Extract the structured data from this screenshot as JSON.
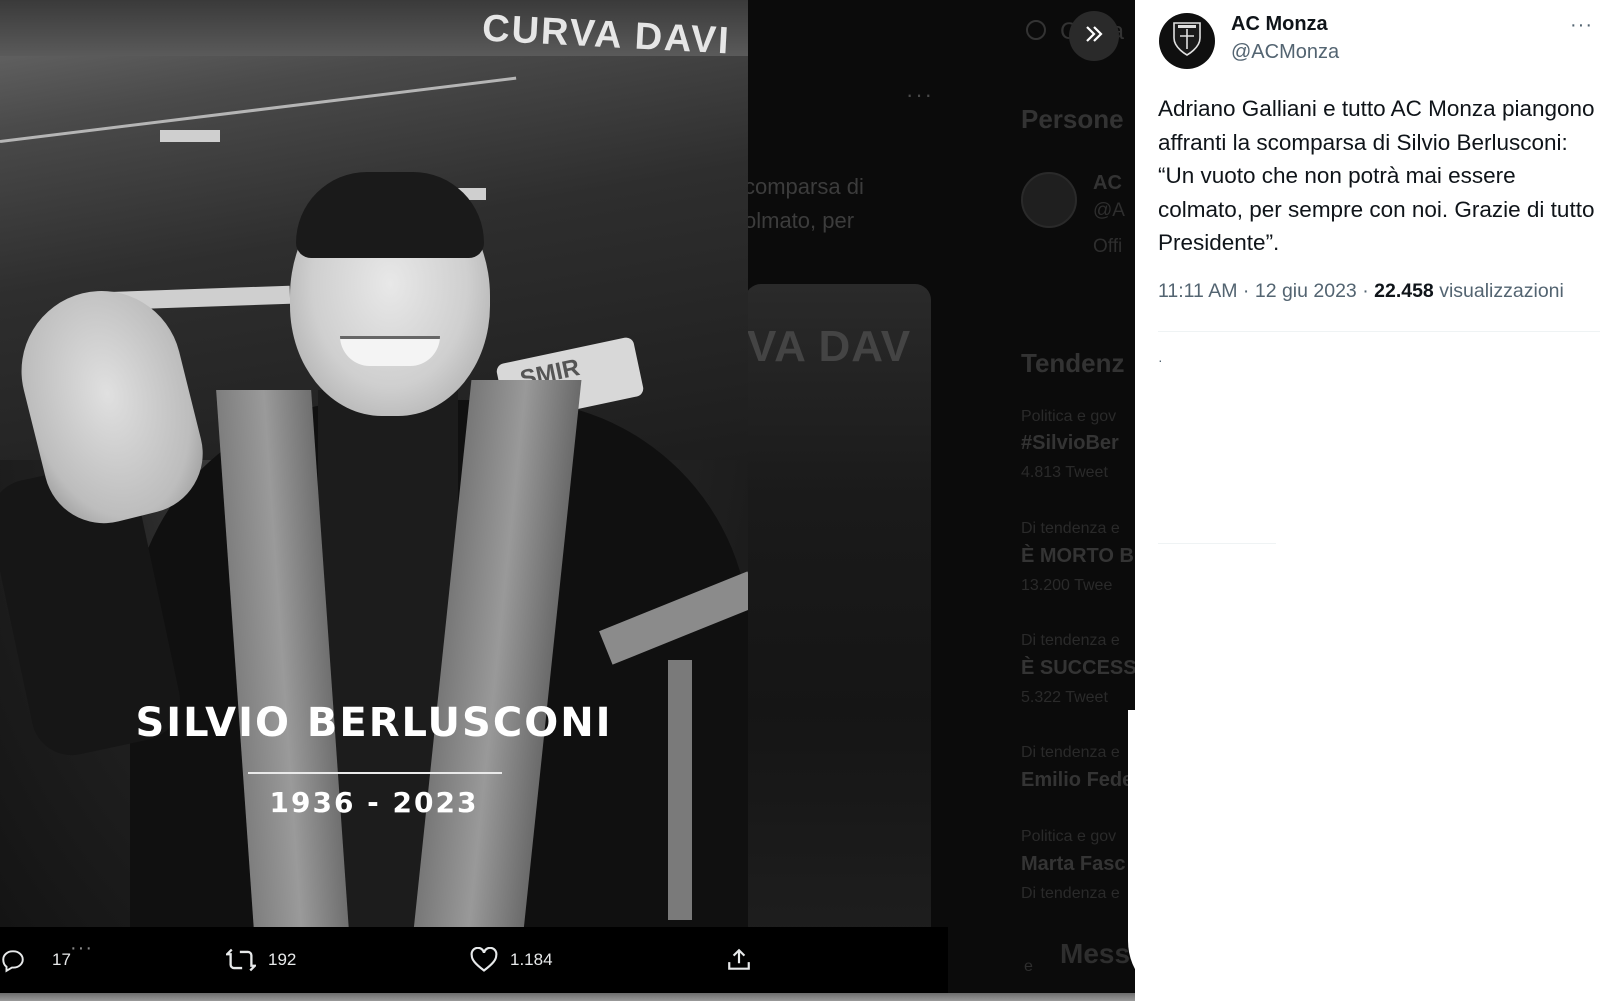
{
  "background": {
    "more_label": "···",
    "tweet_fragment_1": "comparsa di",
    "tweet_fragment_2": "olmato, per",
    "media_text": "VA DAV",
    "search_label": "Cerca",
    "who_to_follow_title": "Persone",
    "account_name": "AC",
    "account_handle": "@A",
    "account_bio": "Offi",
    "trends_title": "Tendenz",
    "trends": [
      {
        "category": "Politica e gov",
        "name": "#SilvioBer",
        "count": "4.813 Tweet"
      },
      {
        "category": "Di tendenza e",
        "name": "È MORTO B",
        "count": "13.200 Twee"
      },
      {
        "category": "Di tendenza e",
        "name": "È SUCCESS",
        "count": "5.322 Tweet"
      },
      {
        "category": "Di tendenza e",
        "name": "Emilio Fede",
        "count": ""
      },
      {
        "category": "Politica e gov",
        "name": "Marta Fasc",
        "count": "Di tendenza e"
      }
    ],
    "messages_label": "Mess",
    "messages_dot": "e"
  },
  "media": {
    "stadium_banner": "CURVA DAVI",
    "sign_text": "SMIR",
    "memorial_name": "SILVIO BERLUSCONI",
    "memorial_years": "1936 - 2023"
  },
  "actions": {
    "replies": "17",
    "more_label": "···",
    "retweets": "192",
    "likes": "1.184"
  },
  "tweet": {
    "author_name": "AC Monza",
    "author_handle": "@ACMonza",
    "more_label": "···",
    "text": "Adriano Galliani e tutto AC Monza piangono affranti la scomparsa di Silvio Berlusconi: “Un vuoto che non potrà mai essere colmato, per sempre con noi. Grazie di tutto Presidente”.",
    "time": "11:11 AM",
    "separator": " · ",
    "date": "12 giu 2023",
    "views_count": "22.458",
    "views_label": "visualizzazioni",
    "stray_mark": "·"
  },
  "colors": {
    "panel_bg": "#ffffff",
    "text_primary": "#0f1419",
    "text_secondary": "#536471",
    "overlay_bg": "#000000"
  },
  "icons": [
    "reply-icon",
    "retweet-icon",
    "like-icon",
    "share-icon",
    "expand-chevrons-icon",
    "search-icon",
    "monza-crest-icon"
  ]
}
